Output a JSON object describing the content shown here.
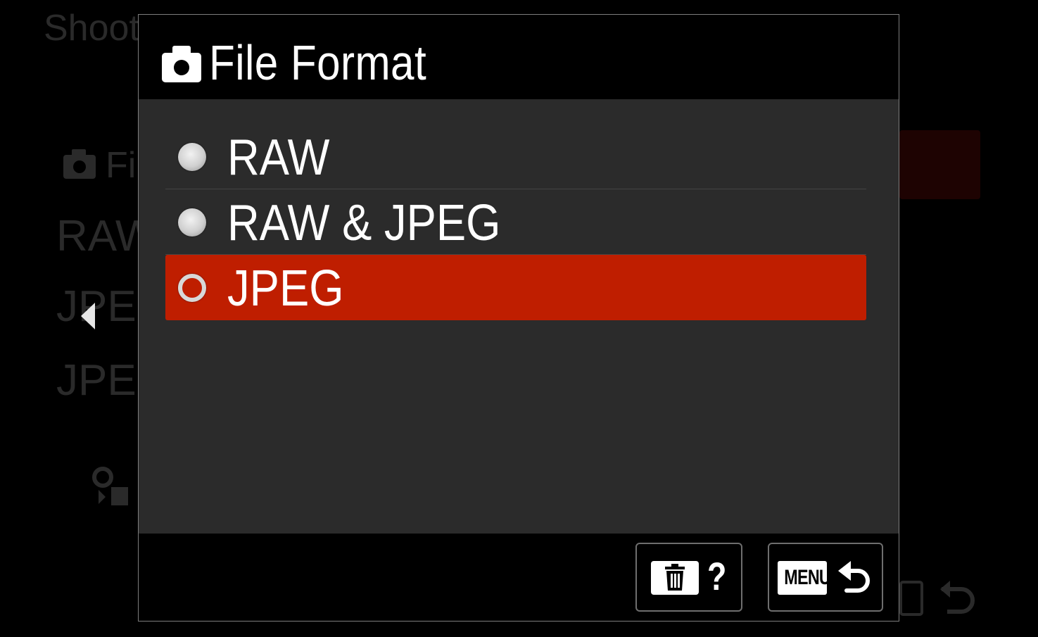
{
  "background_menu": {
    "title_fragment": "Shoot",
    "item_fragment": "Fi",
    "row1": "RAW",
    "row2": "JPEG",
    "row3": "JPEG"
  },
  "dialog": {
    "title": "File Format",
    "title_icon": "camera-icon",
    "options": [
      {
        "label": "RAW",
        "selected": false
      },
      {
        "label": "RAW & JPEG",
        "selected": false
      },
      {
        "label": "JPEG",
        "selected": true
      }
    ],
    "selected_color": "#bf1e00",
    "footer": {
      "help_icon": "trash-icon",
      "help_symbol": "?",
      "back_label": "MENU",
      "back_icon": "return-arrow-icon"
    }
  }
}
